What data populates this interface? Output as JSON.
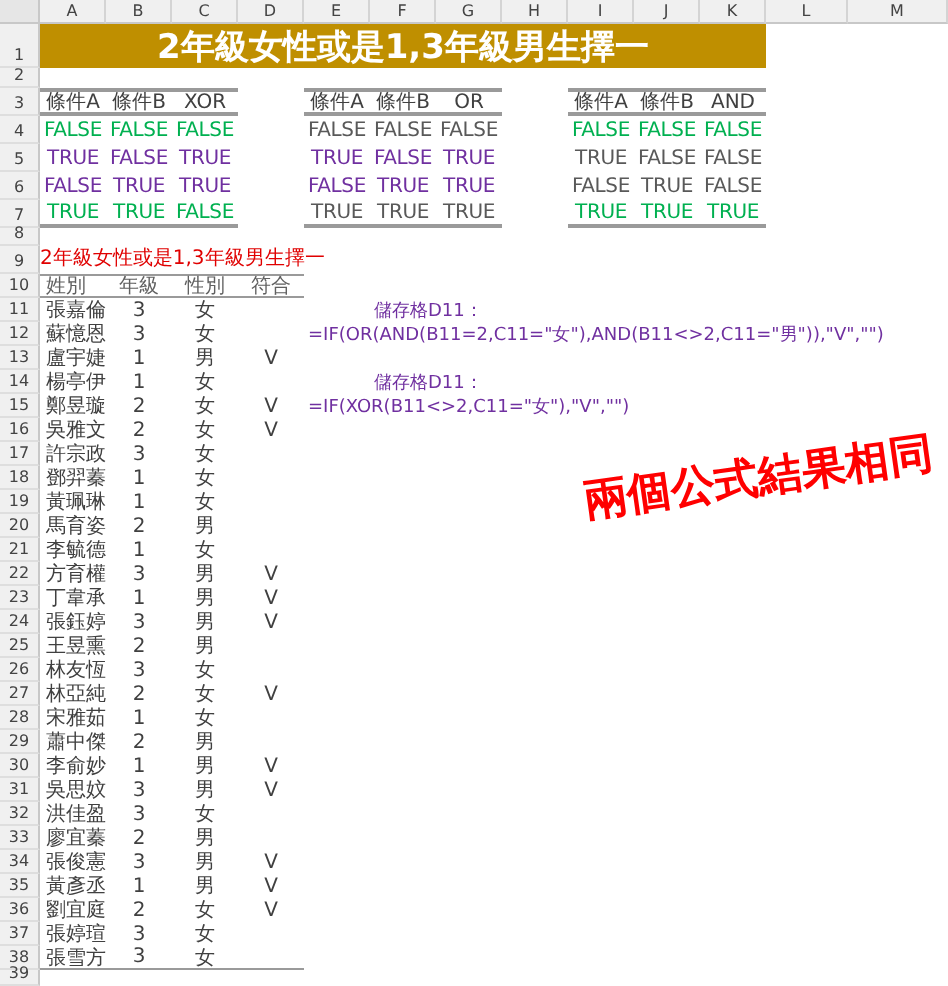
{
  "column_headers": [
    "A",
    "B",
    "C",
    "D",
    "E",
    "F",
    "G",
    "H",
    "I",
    "J",
    "K",
    "L",
    "M"
  ],
  "row_numbers": [
    "1",
    "2",
    "3",
    "4",
    "5",
    "6",
    "7",
    "8",
    "9",
    "10",
    "11",
    "12",
    "13",
    "14",
    "15",
    "16",
    "17",
    "18",
    "19",
    "20",
    "21",
    "22",
    "23",
    "24",
    "25",
    "26",
    "27",
    "28",
    "29",
    "30",
    "31",
    "32",
    "33",
    "34",
    "35",
    "36",
    "37",
    "38",
    "39"
  ],
  "title": "2年級女性或是1,3年級男生擇一",
  "truth_tables": [
    {
      "headers": [
        "條件A",
        "條件B",
        "XOR"
      ],
      "rows": [
        {
          "cells": [
            "FALSE",
            "FALSE",
            "FALSE"
          ],
          "color": "#00b050"
        },
        {
          "cells": [
            "TRUE",
            "FALSE",
            "TRUE"
          ],
          "color": "#7030a0"
        },
        {
          "cells": [
            "FALSE",
            "TRUE",
            "TRUE"
          ],
          "color": "#7030a0"
        },
        {
          "cells": [
            "TRUE",
            "TRUE",
            "FALSE"
          ],
          "color": "#00b050"
        }
      ]
    },
    {
      "headers": [
        "條件A",
        "條件B",
        "OR"
      ],
      "rows": [
        {
          "cells": [
            "FALSE",
            "FALSE",
            "FALSE"
          ],
          "color": "#595959"
        },
        {
          "cells": [
            "TRUE",
            "FALSE",
            "TRUE"
          ],
          "color": "#7030a0"
        },
        {
          "cells": [
            "FALSE",
            "TRUE",
            "TRUE"
          ],
          "color": "#7030a0"
        },
        {
          "cells": [
            "TRUE",
            "TRUE",
            "TRUE"
          ],
          "color": "#595959"
        }
      ]
    },
    {
      "headers": [
        "條件A",
        "條件B",
        "AND"
      ],
      "rows": [
        {
          "cells": [
            "FALSE",
            "FALSE",
            "FALSE"
          ],
          "color": "#00b050"
        },
        {
          "cells": [
            "TRUE",
            "FALSE",
            "FALSE"
          ],
          "color": "#595959"
        },
        {
          "cells": [
            "FALSE",
            "TRUE",
            "FALSE"
          ],
          "color": "#595959"
        },
        {
          "cells": [
            "TRUE",
            "TRUE",
            "TRUE"
          ],
          "color": "#00b050"
        }
      ]
    }
  ],
  "list_title": "2年級女性或是1,3年級男生擇一",
  "list_headers": [
    "姓別",
    "年級",
    "性別",
    "符合"
  ],
  "students": [
    {
      "name": "張嘉倫",
      "grade": "3",
      "gender": "女"
    },
    {
      "name": "蘇憶恩",
      "grade": "3",
      "gender": "女"
    },
    {
      "name": "盧宇婕",
      "grade": "1",
      "gender": "男",
      "match": "V"
    },
    {
      "name": "楊亭伊",
      "grade": "1",
      "gender": "女"
    },
    {
      "name": "鄭昱璇",
      "grade": "2",
      "gender": "女",
      "match": "V"
    },
    {
      "name": "吳雅文",
      "grade": "2",
      "gender": "女",
      "match": "V"
    },
    {
      "name": "許宗政",
      "grade": "3",
      "gender": "女"
    },
    {
      "name": "鄧羿蓁",
      "grade": "1",
      "gender": "女"
    },
    {
      "name": "黃珮琳",
      "grade": "1",
      "gender": "女"
    },
    {
      "name": "馬育姿",
      "grade": "2",
      "gender": "男"
    },
    {
      "name": "李毓德",
      "grade": "1",
      "gender": "女"
    },
    {
      "name": "方育權",
      "grade": "3",
      "gender": "男",
      "match": "V"
    },
    {
      "name": "丁韋承",
      "grade": "1",
      "gender": "男",
      "match": "V"
    },
    {
      "name": "張鈺婷",
      "grade": "3",
      "gender": "男",
      "match": "V"
    },
    {
      "name": "王昱熏",
      "grade": "2",
      "gender": "男"
    },
    {
      "name": "林友恆",
      "grade": "3",
      "gender": "女"
    },
    {
      "name": "林亞純",
      "grade": "2",
      "gender": "女",
      "match": "V"
    },
    {
      "name": "宋雅茹",
      "grade": "1",
      "gender": "女"
    },
    {
      "name": "蕭中傑",
      "grade": "2",
      "gender": "男"
    },
    {
      "name": "李俞妙",
      "grade": "1",
      "gender": "男",
      "match": "V"
    },
    {
      "name": "吳思妏",
      "grade": "3",
      "gender": "男",
      "match": "V"
    },
    {
      "name": "洪佳盈",
      "grade": "3",
      "gender": "女"
    },
    {
      "name": "廖宜蓁",
      "grade": "2",
      "gender": "男"
    },
    {
      "name": "張俊憲",
      "grade": "3",
      "gender": "男",
      "match": "V"
    },
    {
      "name": "黃彥丞",
      "grade": "1",
      "gender": "男",
      "match": "V"
    },
    {
      "name": "劉宜庭",
      "grade": "2",
      "gender": "女",
      "match": "V"
    },
    {
      "name": "張婷瑄",
      "grade": "3",
      "gender": "女"
    },
    {
      "name": "張雪方",
      "grade": "3",
      "gender": "女"
    }
  ],
  "notes": [
    {
      "label": "儲存格D11：",
      "formula": "=IF(OR(AND(B11=2,C11=\"女\"),AND(B11<>2,C11=\"男\")),\"V\",\"\")"
    },
    {
      "label": "儲存格D11：",
      "formula": "=IF(XOR(B11<>2,C11=\"女\"),\"V\",\"\")"
    }
  ],
  "stamp": "兩個公式結果相同"
}
